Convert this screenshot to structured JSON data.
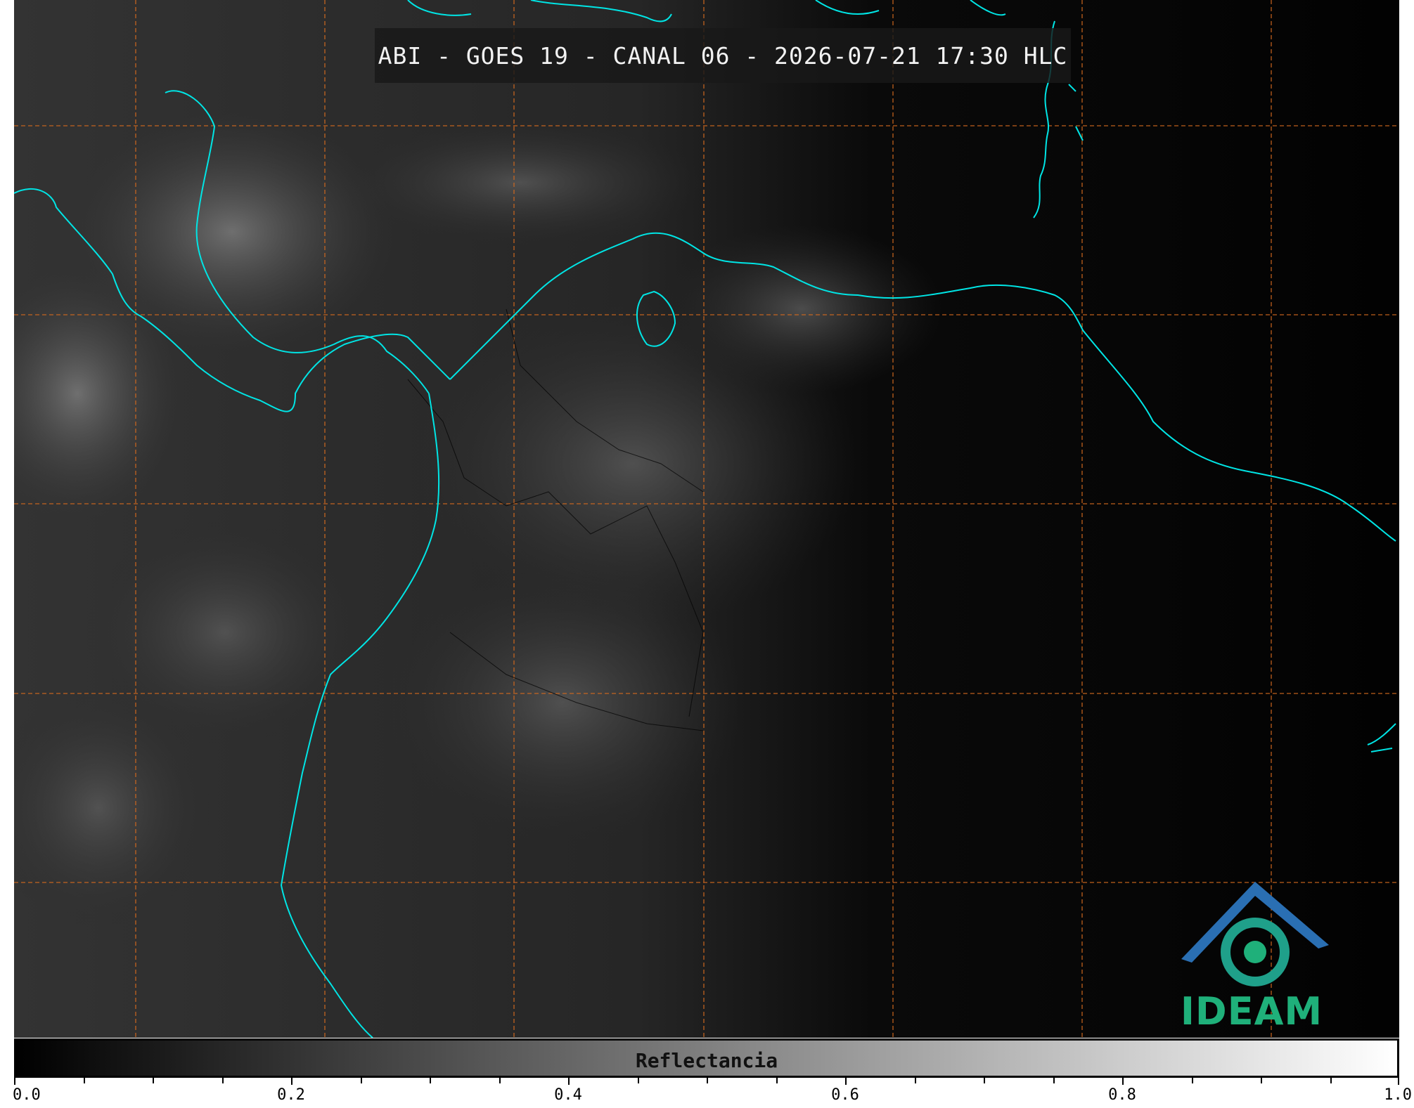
{
  "title": "ABI - GOES 19 - CANAL 06 - 2026-07-21 17:30 HLC",
  "logo": {
    "text": "IDEAM",
    "icon": "ideam-logo-icon"
  },
  "colorbar": {
    "label": "Reflectancia",
    "min": 0.0,
    "max": 1.0,
    "ticks": [
      "0.0",
      "0.2",
      "0.4",
      "0.6",
      "0.8",
      "1.0"
    ],
    "ticks_values": [
      0.0,
      0.2,
      0.4,
      0.6,
      0.8,
      1.0
    ],
    "minor_step": 0.05
  },
  "colors": {
    "coastline": "#00e5e5",
    "gridlines": "#d2691e",
    "background": "#050505",
    "logo_green": "#1fb07a",
    "logo_blue": "#2a6fb3"
  },
  "map": {
    "gridlines": "dashed",
    "type": "satellite-reflectance"
  }
}
